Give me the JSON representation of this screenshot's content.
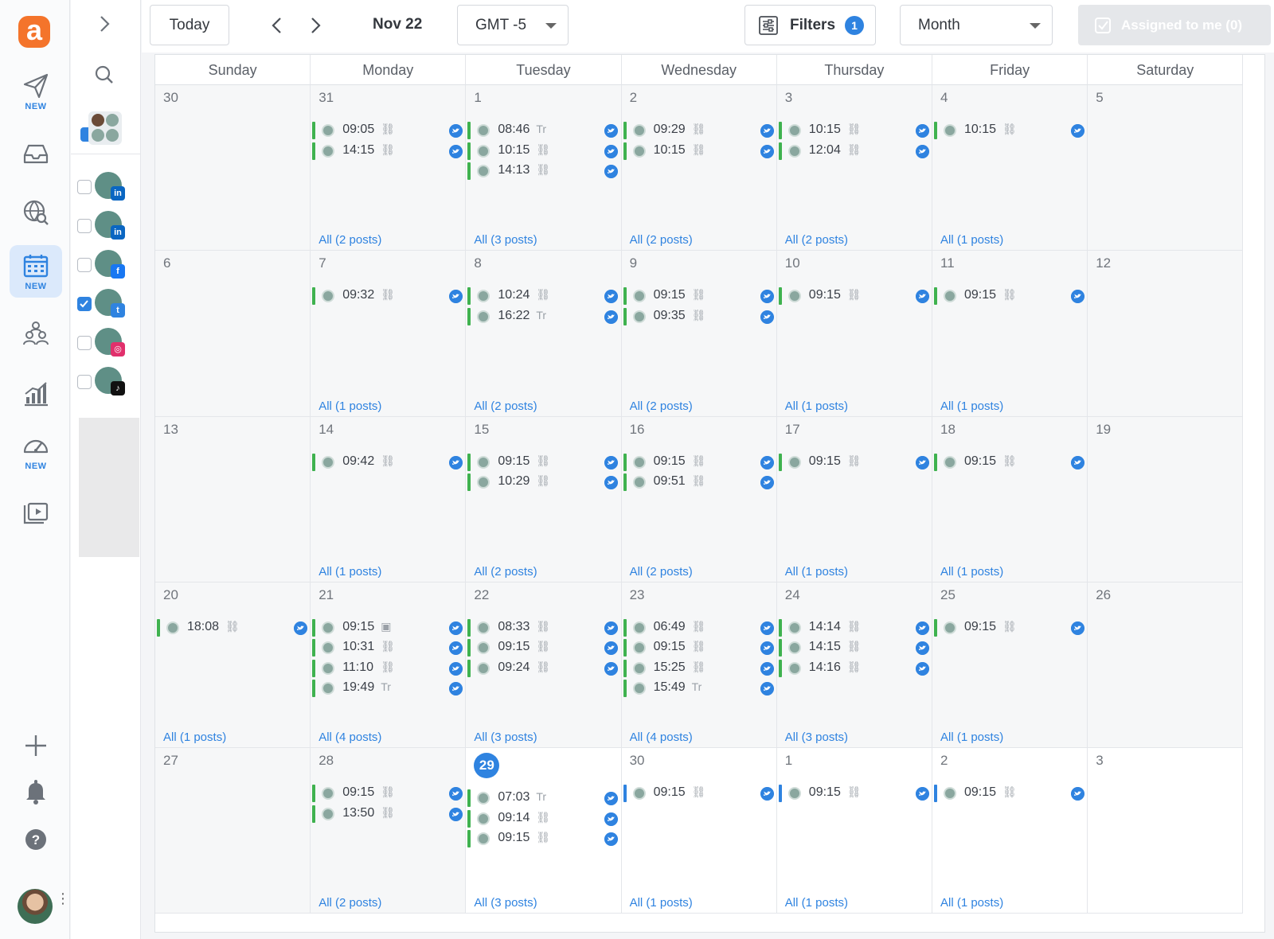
{
  "app": {
    "logo_text": "a",
    "new_badge": "NEW"
  },
  "nav": [
    {
      "name": "send-icon",
      "badge": "NEW"
    },
    {
      "name": "inbox-icon",
      "badge": ""
    },
    {
      "name": "web-search-icon",
      "badge": ""
    },
    {
      "name": "calendar-icon",
      "badge": "NEW",
      "active": true
    },
    {
      "name": "team-icon",
      "badge": ""
    },
    {
      "name": "analytics-icon",
      "badge": ""
    },
    {
      "name": "dashboard-icon",
      "badge": "NEW"
    },
    {
      "name": "media-library-icon",
      "badge": ""
    }
  ],
  "accounts": [
    {
      "network": "linkedin",
      "checked": false,
      "net_glyph": "in",
      "net_color": "#0a66c2"
    },
    {
      "network": "linkedin",
      "checked": false,
      "net_glyph": "in",
      "net_color": "#0a66c2"
    },
    {
      "network": "facebook",
      "checked": false,
      "net_glyph": "f",
      "net_color": "#1877f2"
    },
    {
      "network": "twitter",
      "checked": true,
      "net_glyph": "t",
      "net_color": "#2f83e0"
    },
    {
      "network": "instagram",
      "checked": false,
      "net_glyph": "◎",
      "net_color": "#e1306c"
    },
    {
      "network": "tiktok",
      "checked": false,
      "net_glyph": "♪",
      "net_color": "#111111"
    }
  ],
  "toolbar": {
    "today": "Today",
    "date": "Nov 22",
    "timezone": "GMT -5",
    "filters_label": "Filters",
    "filters_count": "1",
    "view": "Month",
    "assigned": "Assigned to me (0)"
  },
  "weekdays": [
    "Sunday",
    "Monday",
    "Tuesday",
    "Wednesday",
    "Thursday",
    "Friday",
    "Saturday"
  ],
  "colors": {
    "accent": "#2f83e0",
    "post_bar": "#3fb24f",
    "logo": "#f4742b"
  },
  "weeks": [
    [
      {
        "day": "30",
        "posts": [],
        "all": ""
      },
      {
        "day": "31",
        "posts": [
          {
            "t": "09:05",
            "k": "link"
          },
          {
            "t": "14:15",
            "k": "link"
          }
        ],
        "all": "All (2 posts)"
      },
      {
        "day": "1",
        "posts": [
          {
            "t": "08:46",
            "k": "text"
          },
          {
            "t": "10:15",
            "k": "link"
          },
          {
            "t": "14:13",
            "k": "link"
          }
        ],
        "all": "All (3 posts)"
      },
      {
        "day": "2",
        "posts": [
          {
            "t": "09:29",
            "k": "link"
          },
          {
            "t": "10:15",
            "k": "link"
          }
        ],
        "all": "All (2 posts)"
      },
      {
        "day": "3",
        "posts": [
          {
            "t": "10:15",
            "k": "link"
          },
          {
            "t": "12:04",
            "k": "link"
          }
        ],
        "all": "All (2 posts)"
      },
      {
        "day": "4",
        "posts": [
          {
            "t": "10:15",
            "k": "link"
          }
        ],
        "all": "All (1 posts)"
      },
      {
        "day": "5",
        "posts": [],
        "all": ""
      }
    ],
    [
      {
        "day": "6",
        "posts": [],
        "all": ""
      },
      {
        "day": "7",
        "posts": [
          {
            "t": "09:32",
            "k": "link"
          }
        ],
        "all": "All (1 posts)"
      },
      {
        "day": "8",
        "posts": [
          {
            "t": "10:24",
            "k": "link"
          },
          {
            "t": "16:22",
            "k": "text"
          }
        ],
        "all": "All (2 posts)"
      },
      {
        "day": "9",
        "posts": [
          {
            "t": "09:15",
            "k": "link"
          },
          {
            "t": "09:35",
            "k": "link"
          }
        ],
        "all": "All (2 posts)"
      },
      {
        "day": "10",
        "posts": [
          {
            "t": "09:15",
            "k": "link"
          }
        ],
        "all": "All (1 posts)"
      },
      {
        "day": "11",
        "posts": [
          {
            "t": "09:15",
            "k": "link"
          }
        ],
        "all": "All (1 posts)"
      },
      {
        "day": "12",
        "posts": [],
        "all": ""
      }
    ],
    [
      {
        "day": "13",
        "posts": [],
        "all": ""
      },
      {
        "day": "14",
        "posts": [
          {
            "t": "09:42",
            "k": "link"
          }
        ],
        "all": "All (1 posts)"
      },
      {
        "day": "15",
        "posts": [
          {
            "t": "09:15",
            "k": "link"
          },
          {
            "t": "10:29",
            "k": "link"
          }
        ],
        "all": "All (2 posts)"
      },
      {
        "day": "16",
        "posts": [
          {
            "t": "09:15",
            "k": "link"
          },
          {
            "t": "09:51",
            "k": "link"
          }
        ],
        "all": "All (2 posts)"
      },
      {
        "day": "17",
        "posts": [
          {
            "t": "09:15",
            "k": "link"
          }
        ],
        "all": "All (1 posts)"
      },
      {
        "day": "18",
        "posts": [
          {
            "t": "09:15",
            "k": "link"
          }
        ],
        "all": "All (1 posts)"
      },
      {
        "day": "19",
        "posts": [],
        "all": ""
      }
    ],
    [
      {
        "day": "20",
        "posts": [
          {
            "t": "18:08",
            "k": "link"
          }
        ],
        "all": "All (1 posts)"
      },
      {
        "day": "21",
        "posts": [
          {
            "t": "09:15",
            "k": "image"
          },
          {
            "t": "10:31",
            "k": "link"
          },
          {
            "t": "11:10",
            "k": "link"
          },
          {
            "t": "19:49",
            "k": "text"
          }
        ],
        "all": "All (4 posts)"
      },
      {
        "day": "22",
        "posts": [
          {
            "t": "08:33",
            "k": "link"
          },
          {
            "t": "09:15",
            "k": "link"
          },
          {
            "t": "09:24",
            "k": "link"
          }
        ],
        "all": "All (3 posts)"
      },
      {
        "day": "23",
        "posts": [
          {
            "t": "06:49",
            "k": "link"
          },
          {
            "t": "09:15",
            "k": "link"
          },
          {
            "t": "15:25",
            "k": "link"
          },
          {
            "t": "15:49",
            "k": "text"
          }
        ],
        "all": "All (4 posts)"
      },
      {
        "day": "24",
        "posts": [
          {
            "t": "14:14",
            "k": "link"
          },
          {
            "t": "14:15",
            "k": "link"
          },
          {
            "t": "14:16",
            "k": "link"
          }
        ],
        "all": "All (3 posts)"
      },
      {
        "day": "25",
        "posts": [
          {
            "t": "09:15",
            "k": "link"
          }
        ],
        "all": "All (1 posts)"
      },
      {
        "day": "26",
        "posts": [],
        "all": ""
      }
    ],
    [
      {
        "day": "27",
        "posts": [],
        "all": ""
      },
      {
        "day": "28",
        "posts": [
          {
            "t": "09:15",
            "k": "link"
          },
          {
            "t": "13:50",
            "k": "link"
          }
        ],
        "all": "All (2 posts)"
      },
      {
        "day": "29",
        "today": true,
        "posts": [
          {
            "t": "07:03",
            "k": "text"
          },
          {
            "t": "09:14",
            "k": "link"
          },
          {
            "t": "09:15",
            "k": "link"
          }
        ],
        "all": "All (3 posts)"
      },
      {
        "day": "30",
        "posts": [
          {
            "t": "09:15",
            "k": "link",
            "blue": true
          }
        ],
        "all": "All (1 posts)"
      },
      {
        "day": "1",
        "posts": [
          {
            "t": "09:15",
            "k": "link",
            "blue": true
          }
        ],
        "all": "All (1 posts)"
      },
      {
        "day": "2",
        "posts": [
          {
            "t": "09:15",
            "k": "link",
            "blue": true
          }
        ],
        "all": "All (1 posts)"
      },
      {
        "day": "3",
        "posts": [],
        "all": ""
      }
    ]
  ]
}
